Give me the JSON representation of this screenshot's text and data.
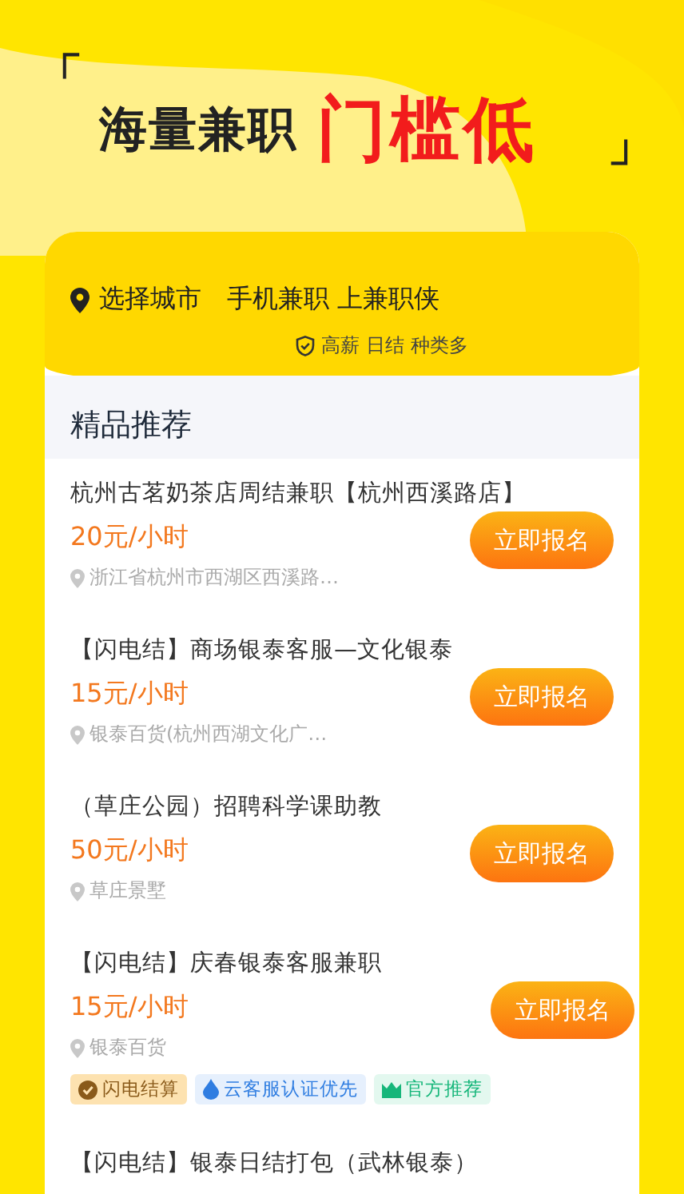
{
  "headline": {
    "open_quote": "「",
    "text": "海量兼职",
    "highlight": "门槛低",
    "close_quote": "」"
  },
  "card": {
    "city": "选择城市",
    "slogan": "手机兼职 上兼职侠",
    "features": "高薪 日结 种类多"
  },
  "section_title": "精品推荐",
  "jobs": [
    {
      "title": "杭州古茗奶茶店周结兼职【杭州西溪路店】",
      "pay": "20元/小时",
      "address": "浙江省杭州市西湖区西溪路…",
      "button": "立即报名"
    },
    {
      "title": "【闪电结】商场银泰客服—文化银泰",
      "pay": "15元/小时",
      "address": "银泰百货(杭州西湖文化广…",
      "button": "立即报名"
    },
    {
      "title": "（草庄公园）招聘科学课助教",
      "pay": "50元/小时",
      "address": "草庄景墅",
      "button": "立即报名"
    },
    {
      "title": "【闪电结】庆春银泰客服兼职",
      "pay": "15元/小时",
      "address": "银泰百货",
      "button": "立即报名",
      "tags": [
        {
          "kind": "check",
          "label": "闪电结算",
          "color": "#8a5a1a"
        },
        {
          "kind": "drop",
          "label": "云客服认证优先",
          "color": "#2f7de1"
        },
        {
          "kind": "crown",
          "label": "官方推荐",
          "color": "#16b67a"
        }
      ]
    },
    {
      "title": "【闪电结】银泰日结打包（武林银泰）"
    }
  ]
}
